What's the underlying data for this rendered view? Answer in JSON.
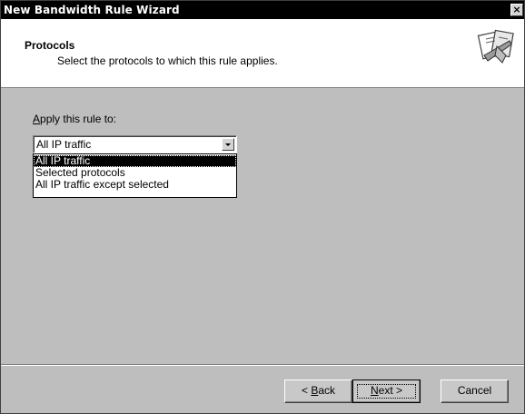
{
  "window": {
    "title": "New Bandwidth Rule Wizard",
    "close_glyph": "×"
  },
  "header": {
    "title": "Protocols",
    "subtitle": "Select the protocols to which this rule applies.",
    "icon": "wizard-icon"
  },
  "apply": {
    "label_access_key": "A",
    "label_rest": "pply this rule to:",
    "selected_value": "All IP traffic",
    "options": [
      "All IP traffic",
      "Selected protocols",
      "All IP traffic except selected"
    ],
    "highlighted_index": 0
  },
  "buttons": {
    "back_prefix": "< ",
    "back_key": "B",
    "back_rest": "ack",
    "next_key": "N",
    "next_rest": "ext >",
    "cancel": "Cancel"
  }
}
